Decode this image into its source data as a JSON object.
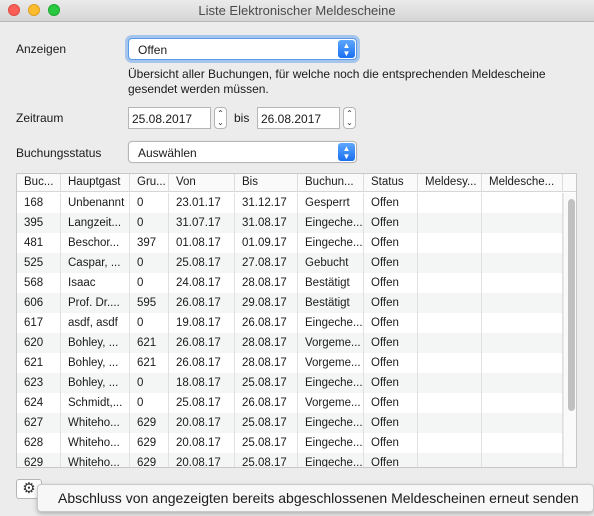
{
  "window": {
    "title": "Liste Elektronischer Meldescheine"
  },
  "form": {
    "anzeigen_label": "Anzeigen",
    "anzeigen_value": "Offen",
    "description": "Übersicht aller Buchungen, für welche noch die entsprechenden Meldescheine gesendet werden müssen.",
    "zeitraum_label": "Zeitraum",
    "date_from": "25.08.2017",
    "bis_label": "bis",
    "date_to": "26.08.2017",
    "buchungsstatus_label": "Buchungsstatus",
    "buchungsstatus_value": "Auswählen"
  },
  "table": {
    "columns": [
      "Buc...",
      "Hauptgast",
      "Gru...",
      "Von",
      "Bis",
      "Buchun...",
      "Status",
      "Meldesy...",
      "Meldesche..."
    ],
    "rows": [
      [
        "168",
        "Unbenannt",
        "0",
        "23.01.17",
        "31.12.17",
        "Gesperrt",
        "Offen",
        "",
        ""
      ],
      [
        "395",
        "Langzeit...",
        "0",
        "31.07.17",
        "31.08.17",
        "Eingeche...",
        "Offen",
        "",
        ""
      ],
      [
        "481",
        "Beschor...",
        "397",
        "01.08.17",
        "01.09.17",
        "Eingeche...",
        "Offen",
        "",
        ""
      ],
      [
        "525",
        "Caspar, ...",
        "0",
        "25.08.17",
        "27.08.17",
        "Gebucht",
        "Offen",
        "",
        ""
      ],
      [
        "568",
        "Isaac",
        "0",
        "24.08.17",
        "28.08.17",
        "Bestätigt",
        "Offen",
        "",
        ""
      ],
      [
        "606",
        "Prof. Dr....",
        "595",
        "26.08.17",
        "29.08.17",
        "Bestätigt",
        "Offen",
        "",
        ""
      ],
      [
        "617",
        "asdf, asdf",
        "0",
        "19.08.17",
        "26.08.17",
        "Eingeche...",
        "Offen",
        "",
        ""
      ],
      [
        "620",
        "Bohley, ...",
        "621",
        "26.08.17",
        "28.08.17",
        "Vorgeme...",
        "Offen",
        "",
        ""
      ],
      [
        "621",
        "Bohley, ...",
        "621",
        "26.08.17",
        "28.08.17",
        "Vorgeme...",
        "Offen",
        "",
        ""
      ],
      [
        "623",
        "Bohley, ...",
        "0",
        "18.08.17",
        "25.08.17",
        "Eingeche...",
        "Offen",
        "",
        ""
      ],
      [
        "624",
        "Schmidt,...",
        "0",
        "25.08.17",
        "26.08.17",
        "Vorgeme...",
        "Offen",
        "",
        ""
      ],
      [
        "627",
        "Whiteho...",
        "629",
        "20.08.17",
        "25.08.17",
        "Eingeche...",
        "Offen",
        "",
        ""
      ],
      [
        "628",
        "Whiteho...",
        "629",
        "20.08.17",
        "25.08.17",
        "Eingeche...",
        "Offen",
        "",
        ""
      ],
      [
        "629",
        "Whiteho...",
        "629",
        "20.08.17",
        "25.08.17",
        "Eingeche...",
        "Offen",
        "",
        ""
      ]
    ]
  },
  "footer": {
    "gear_icon": "gear-icon",
    "tooltip": "Abschluss von angezeigten bereits abgeschlossenen Meldescheinen erneut senden"
  },
  "colors": {
    "accent": "#1a6ff0",
    "row_alt": "#f4f5f5"
  }
}
